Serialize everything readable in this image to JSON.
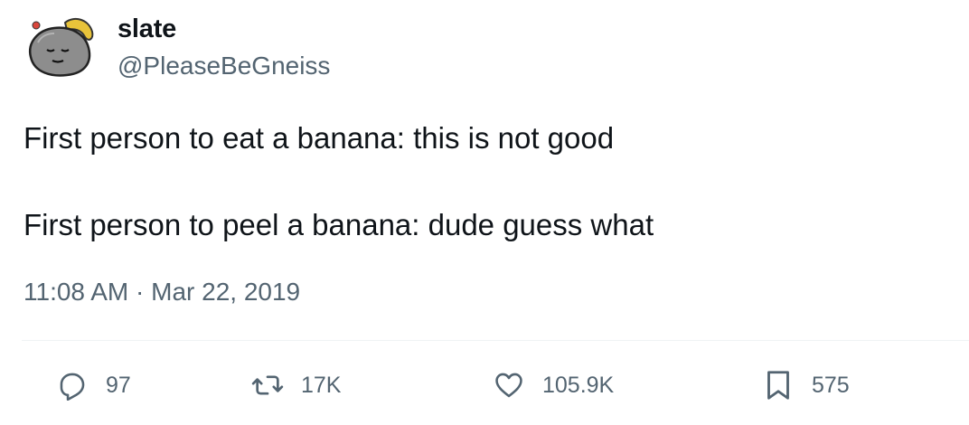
{
  "author": {
    "display_name": "slate",
    "handle": "@PleaseBeGneiss"
  },
  "tweet": {
    "lines": [
      "First person to eat a banana: this is not good",
      "First person to peel a banana: dude guess what"
    ],
    "time": "11:08 AM",
    "separator": "·",
    "date": "Mar 22, 2019"
  },
  "actions": {
    "reply": {
      "icon": "reply-icon",
      "count": "97"
    },
    "retweet": {
      "icon": "retweet-icon",
      "count": "17K"
    },
    "like": {
      "icon": "heart-icon",
      "count": "105.9K"
    },
    "bookmark": {
      "icon": "bookmark-icon",
      "count": "575"
    }
  },
  "colors": {
    "text": "#0f1419",
    "secondary": "#536471",
    "divider": "#eff3f4"
  }
}
